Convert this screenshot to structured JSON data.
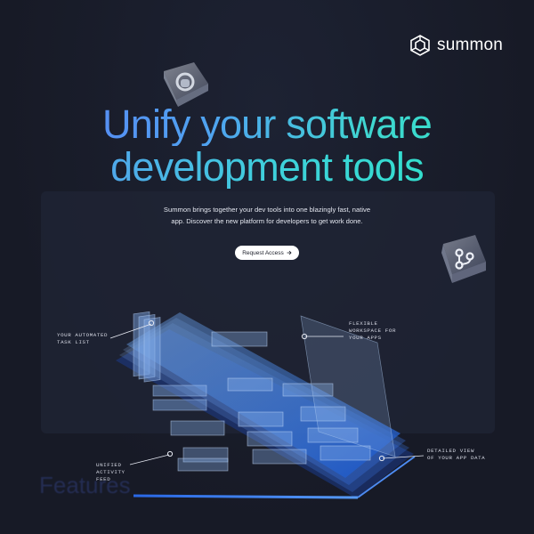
{
  "brand": {
    "name": "summon"
  },
  "hero": {
    "title_line1": "Unify your software",
    "title_line2": "development tools",
    "subtitle_line1": "Summon brings together your dev tools into one blazingly fast, native",
    "subtitle_line2": "app. Discover the new platform for developers to get work done.",
    "cta_label": "Request Access",
    "cta_icon": "arrow-right-icon"
  },
  "callouts": {
    "task_list": "YOUR AUTOMATED\nTASK LIST",
    "workspace": "FLEXIBLE\nWORKSPACE FOR\nYOUR APPS",
    "activity": "UNIFIED\nACTIVITY\nFEED",
    "detail": "DETAILED VIEW\nOF YOUR APP DATA"
  },
  "section": {
    "heading": "Features"
  },
  "colors": {
    "background": "#191d2a",
    "accent_blue": "#5b7cf5",
    "accent_teal": "#2fe0c6"
  },
  "icons": [
    "summon-logo-icon",
    "github-key-icon",
    "git-branch-key-icon",
    "arrow-right-icon"
  ]
}
